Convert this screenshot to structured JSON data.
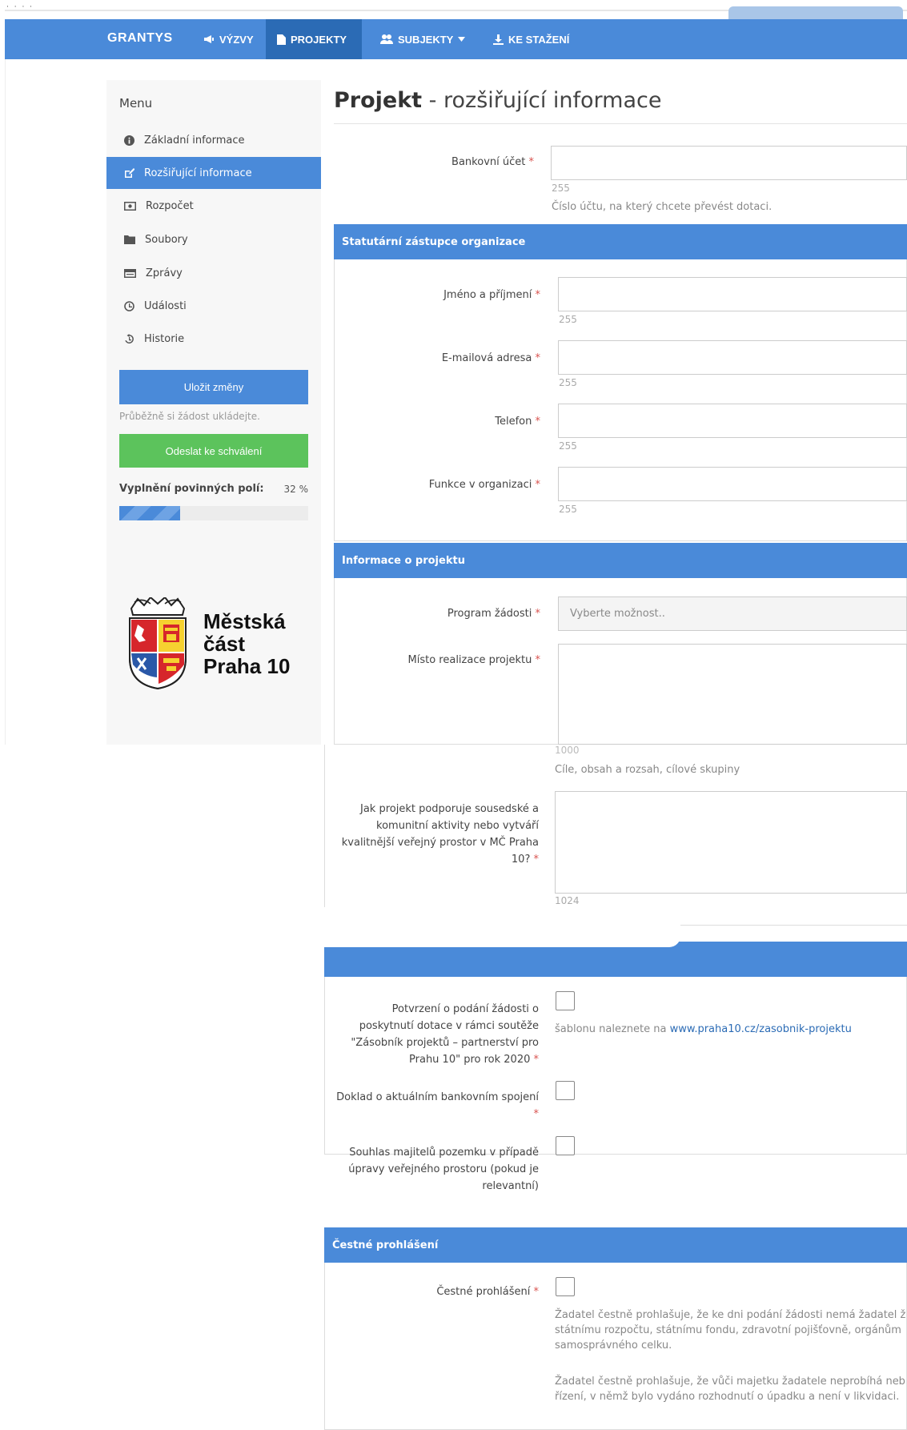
{
  "navbar": {
    "brand": "GRANTYS",
    "items": [
      {
        "label": "VÝZVY",
        "icon": "megaphone-icon"
      },
      {
        "label": "PROJEKTY",
        "icon": "document-icon",
        "active": true
      },
      {
        "label": "SUBJEKTY",
        "icon": "users-icon",
        "dropdown": true
      },
      {
        "label": "KE STAŽENÍ",
        "icon": "download-icon"
      }
    ]
  },
  "sidebar": {
    "title": "Menu",
    "items": [
      {
        "label": "Základní informace",
        "icon": "info-icon"
      },
      {
        "label": "Rozšiřující informace",
        "icon": "edit-icon",
        "active": true
      },
      {
        "label": "Rozpočet",
        "icon": "money-icon"
      },
      {
        "label": "Soubory",
        "icon": "folder-icon"
      },
      {
        "label": "Zprávy",
        "icon": "message-icon"
      },
      {
        "label": "Události",
        "icon": "clock-icon"
      },
      {
        "label": "Historie",
        "icon": "history-icon"
      }
    ],
    "save_label": "Uložit změny",
    "save_hint": "Průběžně si žádost ukládejte.",
    "send_label": "Odeslat ke schválení",
    "progress_label": "Vyplnění povinných polí:",
    "progress_text": "32 %",
    "progress_value": 32,
    "logo_line1": "Městská",
    "logo_line2": "část",
    "logo_line3": "Praha 10"
  },
  "page": {
    "title_bold": "Projekt",
    "title_rest": " - rozšiřující informace"
  },
  "bank": {
    "label": "Bankovní účet",
    "counter": "255",
    "help": "Číslo účtu, na který chcete převést dotaci."
  },
  "statutory": {
    "heading": "Statutární zástupce organizace",
    "fields": [
      {
        "label": "Jméno a příjmení",
        "counter": "255"
      },
      {
        "label": "E-mailová adresa",
        "counter": "255"
      },
      {
        "label": "Telefon",
        "counter": "255"
      },
      {
        "label": "Funkce v organizaci",
        "counter": "255"
      }
    ]
  },
  "project_info": {
    "heading": "Informace o projektu",
    "program_label": "Program žádosti",
    "program_placeholder": "Vyberte možnost..",
    "place_label": "Místo realizace projektu",
    "place_counter": "1000",
    "place_help": "Cíle, obsah a rozsah, cílové skupiny",
    "support_label": "Jak projekt podporuje sousedské a komunitní aktivity nebo vytváří kvalitnější veřejný prostor v MČ Praha 10?",
    "support_counter": "1024"
  },
  "attachments": {
    "confirm_label": "Potvrzení o podání žádosti o poskytnutí dotace v rámci soutěže \"Zásobník projektů – partnerství pro Prahu 10\" pro rok 2020",
    "confirm_help": "šablonu naleznete na ",
    "confirm_link": "www.praha10.cz/zasobnik-projektu",
    "bank_doc_label": "Doklad o aktuálním bankovním spojení",
    "owner_label": "Souhlas majitelů pozemku v případě úpravy veřejného prostoru (pokud je relevantní)"
  },
  "honor": {
    "heading": "Čestné prohlášení",
    "label": "Čestné prohlášení",
    "text1": "Žadatel čestně prohlašuje, že ke dni podání žádosti nemá žadatel ž",
    "text2": "státnímu rozpočtu, státnímu fondu, zdravotní pojišťovně, orgánům",
    "text3": "samosprávného celku.",
    "text4": "Žadatel čestně prohlašuje, že vůči majetku žadatele neprobíhá neb",
    "text5": "řízení, v němž bylo vydáno rozhodnutí o úpadku a není v likvidaci."
  },
  "required_mark": "*"
}
